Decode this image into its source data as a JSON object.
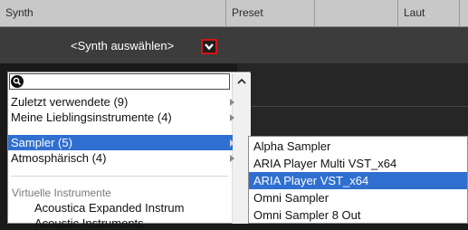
{
  "header": {
    "columns": [
      "Synth",
      "Preset",
      "",
      "Laut",
      ""
    ]
  },
  "synth": {
    "selector_label": "<Synth auswählen>"
  },
  "menu": {
    "search_placeholder": "",
    "items": [
      {
        "label": "Zuletzt verwendete (9)"
      },
      {
        "label": "Meine Lieblingsinstrumente (4)"
      },
      {
        "label": "Sampler (5)"
      },
      {
        "label": "Atmosphärisch (4)"
      }
    ],
    "section_title": "Virtuelle Instrumente",
    "sub_items": [
      {
        "label": "Acoustica Expanded Instrum"
      },
      {
        "label": "Acoustic Instruments"
      }
    ]
  },
  "submenu": {
    "items": [
      {
        "label": "Alpha Sampler"
      },
      {
        "label": "ARIA Player Multi VST_x64"
      },
      {
        "label": "ARIA Player VST_x64"
      },
      {
        "label": "Omni Sampler"
      },
      {
        "label": "Omni Sampler 8 Out"
      }
    ]
  },
  "colors": {
    "selection": "#2f6fd0",
    "dropdown_button_border": "#d21414"
  }
}
